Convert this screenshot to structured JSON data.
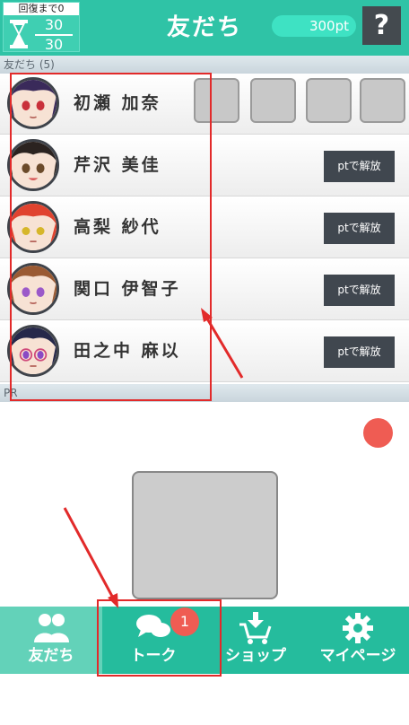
{
  "header": {
    "recovery_label": "回復まで0",
    "recovery_current": "30",
    "recovery_max": "30",
    "title": "友だち",
    "points": "300pt",
    "help": "?"
  },
  "friends_section": {
    "label": "友だち (5)"
  },
  "friends": [
    {
      "name": "初瀬 加奈",
      "unlock": ""
    },
    {
      "name": "芹沢 美佳",
      "unlock": "ptで解放"
    },
    {
      "name": "高梨 紗代",
      "unlock": "ptで解放"
    },
    {
      "name": "関口 伊智子",
      "unlock": "ptで解放"
    },
    {
      "name": "田之中 麻以",
      "unlock": "ptで解放"
    }
  ],
  "pr_section": {
    "label": "PR"
  },
  "tabs": [
    {
      "label": "友だち",
      "icon": "friends-icon",
      "active": true
    },
    {
      "label": "トーク",
      "icon": "talk-icon",
      "badge": "1"
    },
    {
      "label": "ショップ",
      "icon": "shop-icon"
    },
    {
      "label": "マイページ",
      "icon": "gear-icon"
    }
  ],
  "colors": {
    "brand": "#2fc3a6",
    "tab_active": "#63d2b9",
    "badge": "#ef5c53",
    "annotation": "#e22a2a",
    "button_dark": "#40474f"
  }
}
